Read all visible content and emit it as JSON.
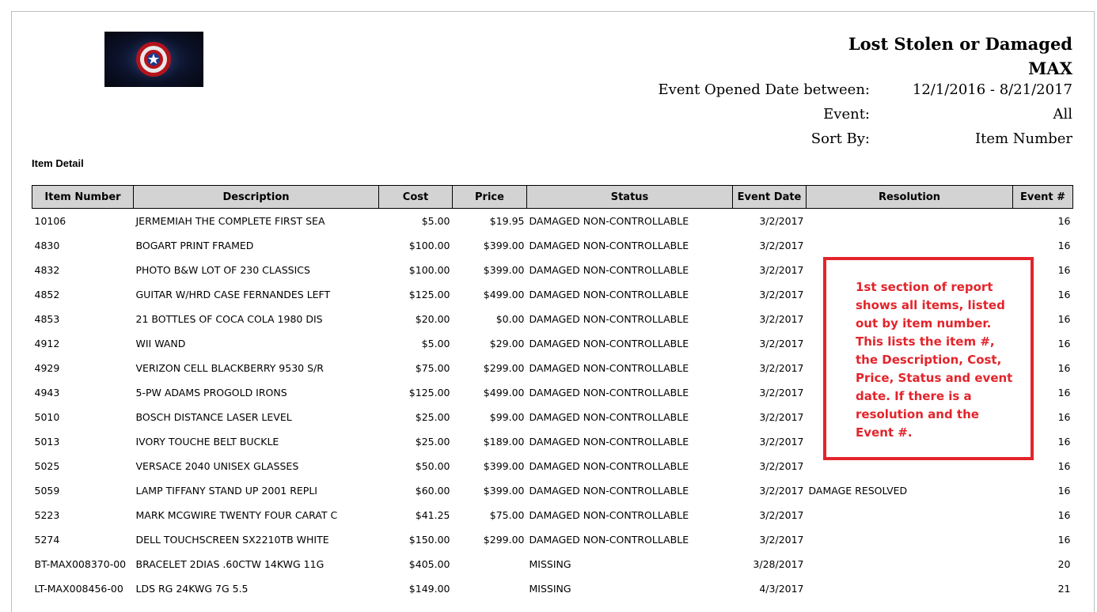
{
  "report": {
    "title_line1": "Lost Stolen or Damaged",
    "title_line2": "MAX",
    "event_opened_label": "Event Opened Date between:",
    "event_opened_value": "12/1/2016 - 8/21/2017",
    "event_label": "Event:",
    "event_value": "All",
    "sort_label": "Sort By:",
    "sort_value": "Item Number",
    "section_title": "Item Detail"
  },
  "logo": {
    "icon": "shield-logo-icon"
  },
  "table": {
    "headers": [
      "Item Number",
      "Description",
      "Cost",
      "Price",
      "Status",
      "Event Date",
      "Resolution",
      "Event #"
    ],
    "rows": [
      [
        "10106",
        "JERMEMIAH THE COMPLETE FIRST SEA",
        "$5.00",
        "$19.95",
        "DAMAGED NON-CONTROLLABLE",
        "3/2/2017",
        "",
        "16"
      ],
      [
        "4830",
        "BOGART PRINT FRAMED",
        "$100.00",
        "$399.00",
        "DAMAGED NON-CONTROLLABLE",
        "3/2/2017",
        "",
        "16"
      ],
      [
        "4832",
        "PHOTO B&W LOT OF 230 CLASSICS",
        "$100.00",
        "$399.00",
        "DAMAGED NON-CONTROLLABLE",
        "3/2/2017",
        "",
        "16"
      ],
      [
        "4852",
        "GUITAR W/HRD CASE FERNANDES LEFT",
        "$125.00",
        "$499.00",
        "DAMAGED NON-CONTROLLABLE",
        "3/2/2017",
        "",
        "16"
      ],
      [
        "4853",
        "21 BOTTLES OF COCA COLA 1980 DIS",
        "$20.00",
        "$0.00",
        "DAMAGED NON-CONTROLLABLE",
        "3/2/2017",
        "",
        "16"
      ],
      [
        "4912",
        "WII WAND",
        "$5.00",
        "$29.00",
        "DAMAGED NON-CONTROLLABLE",
        "3/2/2017",
        "",
        "16"
      ],
      [
        "4929",
        "VERIZON CELL BLACKBERRY 9530 S/R",
        "$75.00",
        "$299.00",
        "DAMAGED NON-CONTROLLABLE",
        "3/2/2017",
        "",
        "16"
      ],
      [
        "4943",
        "5-PW ADAMS PROGOLD IRONS",
        "$125.00",
        "$499.00",
        "DAMAGED NON-CONTROLLABLE",
        "3/2/2017",
        "",
        "16"
      ],
      [
        "5010",
        "BOSCH DISTANCE LASER LEVEL",
        "$25.00",
        "$99.00",
        "DAMAGED NON-CONTROLLABLE",
        "3/2/2017",
        "",
        "16"
      ],
      [
        "5013",
        "IVORY TOUCHE BELT BUCKLE",
        "$25.00",
        "$189.00",
        "DAMAGED NON-CONTROLLABLE",
        "3/2/2017",
        "",
        "16"
      ],
      [
        "5025",
        "VERSACE 2040 UNISEX GLASSES",
        "$50.00",
        "$399.00",
        "DAMAGED NON-CONTROLLABLE",
        "3/2/2017",
        "",
        "16"
      ],
      [
        "5059",
        "LAMP TIFFANY STAND UP 2001 REPLI",
        "$60.00",
        "$399.00",
        "DAMAGED NON-CONTROLLABLE",
        "3/2/2017",
        "DAMAGE RESOLVED",
        "16"
      ],
      [
        "5223",
        "MARK MCGWIRE TWENTY FOUR CARAT C",
        "$41.25",
        "$75.00",
        "DAMAGED NON-CONTROLLABLE",
        "3/2/2017",
        "",
        "16"
      ],
      [
        "5274",
        "DELL TOUCHSCREEN SX2210TB WHITE",
        "$150.00",
        "$299.00",
        "DAMAGED NON-CONTROLLABLE",
        "3/2/2017",
        "",
        "16"
      ],
      [
        "BT-MAX008370-00",
        "BRACELET 2DIAS .60CTW 14KWG 11G",
        "$405.00",
        "",
        "MISSING",
        "3/28/2017",
        "",
        "20"
      ],
      [
        "LT-MAX008456-00",
        "LDS RG 24KWG 7G 5.5",
        "$149.00",
        "",
        "MISSING",
        "4/3/2017",
        "",
        "21"
      ]
    ]
  },
  "callout": {
    "text": "1st section of report shows all items, listed out by item number.  This lists the item #, the Description, Cost, Price, Status and event date.  If there is a resolution and the Event #."
  },
  "colors": {
    "callout": "#e3242b",
    "header_bg": "#d3d3d3"
  }
}
